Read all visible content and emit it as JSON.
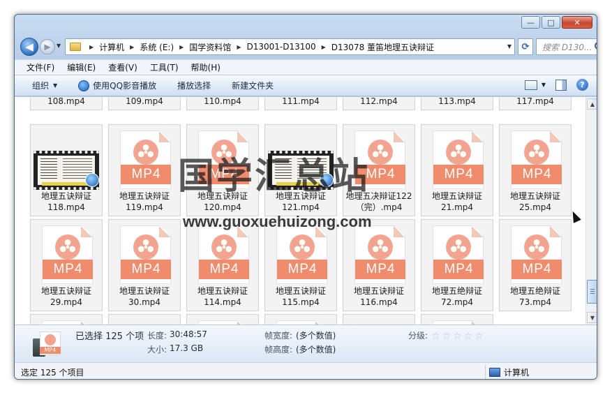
{
  "window": {
    "caption_buttons": {
      "minimize": "—",
      "maximize": "□",
      "close": "✕"
    }
  },
  "nav": {
    "back_icon": "◀",
    "forward_icon": "▶",
    "breadcrumb": [
      "计算机",
      "系统 (E:)",
      "国学资料馆",
      "D13001-D13100",
      "D13078 董笛地理五诀辩证"
    ],
    "search_placeholder": "搜索 D130..."
  },
  "menu": [
    "文件(F)",
    "编辑(E)",
    "查看(V)",
    "工具(T)",
    "帮助(H)"
  ],
  "toolbar": {
    "organize": "组织",
    "play_qq": "使用QQ影音播放",
    "play_selection": "播放选择",
    "new_folder": "新建文件夹",
    "help_icon": "?"
  },
  "files_top_row": [
    "108.mp4",
    "109.mp4",
    "110.mp4",
    "111.mp4",
    "112.mp4",
    "113.mp4",
    "117.mp4"
  ],
  "files_row2": [
    {
      "line1": "地理五诀辩证",
      "line2": "118.mp4",
      "thumb": true
    },
    {
      "line1": "地理五诀辩证",
      "line2": "119.mp4",
      "thumb": false
    },
    {
      "line1": "地理五诀辩证",
      "line2": "120.mp4",
      "thumb": false
    },
    {
      "line1": "地理五诀辩证",
      "line2": "121.mp4",
      "thumb": true
    },
    {
      "line1": "地理五决辩证122",
      "line2": "（完）.mp4",
      "thumb": false
    },
    {
      "line1": "地理五诀辩证",
      "line2": "21.mp4",
      "thumb": false
    },
    {
      "line1": "地理五诀辩证",
      "line2": "25.mp4",
      "thumb": false
    }
  ],
  "files_row3": [
    {
      "line1": "地理五诀辩证",
      "line2": "29.mp4"
    },
    {
      "line1": "地理五诀辩证",
      "line2": "30.mp4"
    },
    {
      "line1": "地理五诀辩证",
      "line2": "114.mp4"
    },
    {
      "line1": "地理五诀辩证",
      "line2": "115.mp4"
    },
    {
      "line1": "地理五诀辩证",
      "line2": "116.mp4"
    },
    {
      "line1": "地理五绝辩证",
      "line2": "72.mp4"
    },
    {
      "line1": "地理五绝辩证",
      "line2": "73.mp4"
    }
  ],
  "mp4_badge": "MP4",
  "watermark": {
    "title": "国学汇总站",
    "url": "www.guoxuehuizong.com"
  },
  "details": {
    "selected": "已选择 125 个项",
    "length_key": "长度:",
    "length_val": "30:48:57",
    "size_key": "大小:",
    "size_val": "17.3 GB",
    "fwidth_key": "帧宽度:",
    "fwidth_val": "(多个数值)",
    "fheight_key": "帧高度:",
    "fheight_val": "(多个数值)",
    "rating_key": "分级:",
    "rating_stars": 0,
    "icon_badge": "MP4"
  },
  "status": {
    "left": "选定 125 个项目",
    "right": "计算机"
  }
}
